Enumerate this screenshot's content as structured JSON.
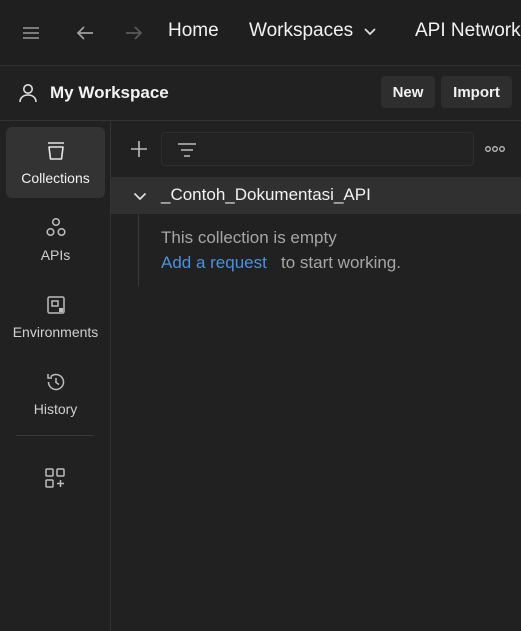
{
  "topbar": {
    "home_label": "Home",
    "workspaces_label": "Workspaces",
    "api_network_label": "API Network"
  },
  "workspace": {
    "title": "My Workspace",
    "new_label": "New",
    "import_label": "Import"
  },
  "sidebar": {
    "items": [
      {
        "label": "Collections",
        "icon": "collections-icon",
        "active": true
      },
      {
        "label": "APIs",
        "icon": "apis-icon",
        "active": false
      },
      {
        "label": "Environments",
        "icon": "environments-icon",
        "active": false
      },
      {
        "label": "History",
        "icon": "history-icon",
        "active": false
      }
    ],
    "more_icon": "add-widget-icon"
  },
  "main": {
    "search_placeholder": "",
    "collection": {
      "name": "_Contoh_Dokumentasi_API",
      "empty_text": "This collection is empty",
      "add_link": "Add a request",
      "tail_text": "to start working."
    }
  },
  "colors": {
    "background": "#212121",
    "active_item": "#333333",
    "link": "#4a90e2"
  }
}
